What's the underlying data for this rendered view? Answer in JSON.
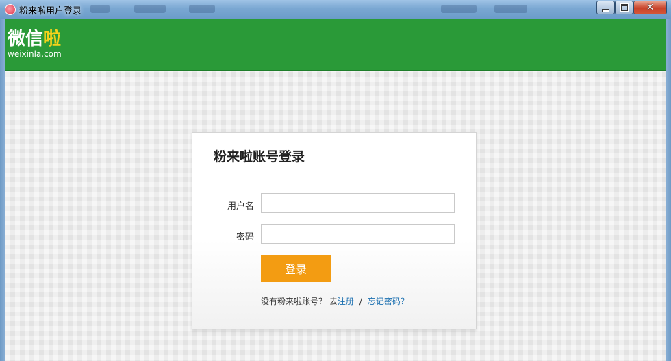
{
  "window": {
    "title": "粉来啦用户登录",
    "close_glyph": "✕"
  },
  "header": {
    "logo_main_white": "微信",
    "logo_main_accent": "啦",
    "logo_sub": "weixinla.com",
    "brand_color": "#2a9a38",
    "accent_color": "#f5d21a"
  },
  "login": {
    "title": "粉来啦账号登录",
    "username_label": "用户名",
    "username_value": "",
    "password_label": "密码",
    "password_value": "",
    "submit_label": "登录",
    "submit_color": "#f39c12",
    "no_account_text": "没有粉来啦账号？ 去",
    "register_link": "注册",
    "separator": "/",
    "forgot_link": "忘记密码？",
    "link_color": "#1a6fb0"
  },
  "icons": {
    "app": "app-logo-icon",
    "minimize": "minimize-icon",
    "maximize": "maximize-icon",
    "close": "close-icon"
  }
}
